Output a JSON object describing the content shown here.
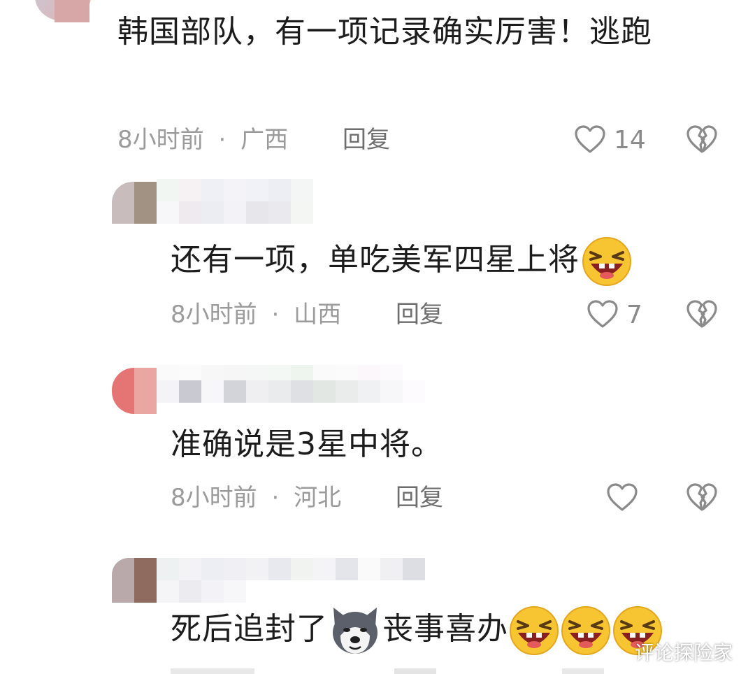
{
  "comments": [
    {
      "text": "韩国部队，有一项记录确实厉害！逃跑",
      "time": "8小时前",
      "sep": "·",
      "location": "广西",
      "reply_label": "回复",
      "likes": "14"
    },
    {
      "text": "还有一项，单吃美军四星上将",
      "time": "8小时前",
      "sep": "·",
      "location": "山西",
      "reply_label": "回复",
      "likes": "7",
      "emoji_suffix": [
        "laughing-tears"
      ]
    },
    {
      "text": "准确说是3星中将。",
      "time": "8小时前",
      "sep": "·",
      "location": "河北",
      "reply_label": "回复",
      "likes": ""
    },
    {
      "text_part1": "死后追封了",
      "text_part2": "丧事喜办",
      "emoji_inline": "husky-doge",
      "emoji_suffix": [
        "laughing-tears",
        "laughing-tears",
        "laughing-tears"
      ]
    }
  ],
  "watermark": "评论探险家",
  "colors": {
    "text": "#1c1c1c",
    "meta": "#9b9b9b",
    "icon": "#8a8a8a",
    "emoji_yellow": "#f7c531"
  },
  "icons": [
    "heart-icon",
    "broken-heart-icon"
  ]
}
